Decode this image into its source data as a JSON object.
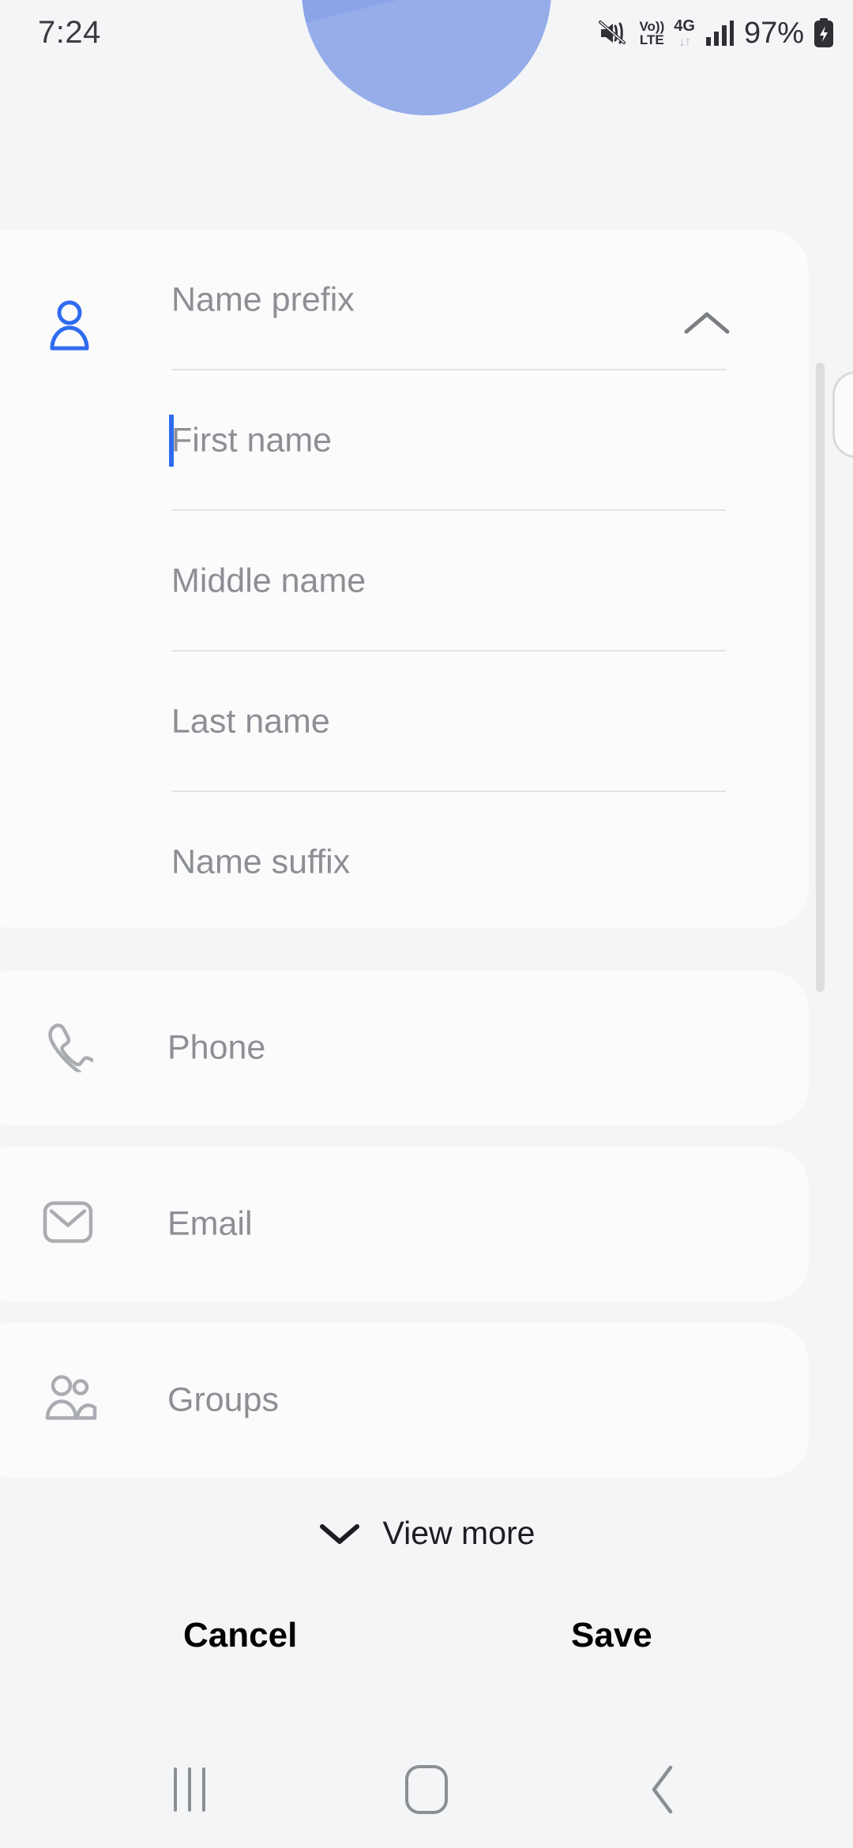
{
  "status_bar": {
    "time": "7:24",
    "battery_percent": "97%",
    "network_volte_top": "Vo))",
    "network_volte_bottom": "LTE",
    "network_generation": "4G",
    "data_arrows": "↓↑",
    "icons": [
      "mute-icon",
      "volte-icon",
      "4g-icon",
      "signal-icon",
      "battery-charging-icon"
    ]
  },
  "avatar": {
    "color": "#8ba4e8",
    "name": "contact-avatar"
  },
  "name_card": {
    "icon": "person-icon",
    "accent_color": "#2f6bf0",
    "collapse_icon": "chevron-up-icon",
    "fields": [
      {
        "placeholder": "Name prefix",
        "value": "",
        "focused": false
      },
      {
        "placeholder": "First name",
        "value": "",
        "focused": true
      },
      {
        "placeholder": "Middle name",
        "value": "",
        "focused": false
      },
      {
        "placeholder": "Last name",
        "value": "",
        "focused": false
      },
      {
        "placeholder": "Name suffix",
        "value": "",
        "focused": false
      }
    ]
  },
  "detail_cards": [
    {
      "label": "Phone",
      "icon": "phone-icon"
    },
    {
      "label": "Email",
      "icon": "envelope-icon"
    },
    {
      "label": "Groups",
      "icon": "people-icon"
    }
  ],
  "view_more": {
    "label": "View more",
    "icon": "chevron-down-icon"
  },
  "actions": {
    "cancel_label": "Cancel",
    "save_label": "Save"
  },
  "nav_bar": {
    "recents": "recents-icon",
    "home": "home-icon",
    "back": "back-icon"
  }
}
